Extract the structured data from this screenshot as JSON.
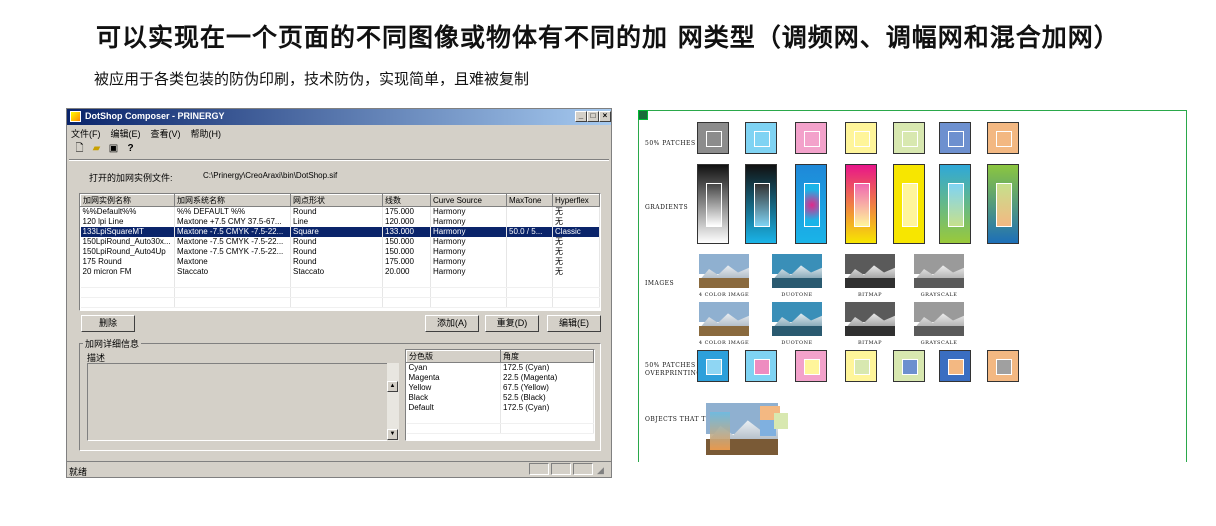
{
  "headline": "可以实现在一个页面的不同图像或物体有不同的加 网类型（调频网、调幅网和混合加网）",
  "subheadline": "被应用于各类包装的防伪印刷，技术防伪，实现简单，且难被复制",
  "window": {
    "title": "DotShop Composer - PRINERGY",
    "caption_buttons": [
      "_",
      "□",
      "×"
    ],
    "menu": [
      "文件(F)",
      "编辑(E)",
      "查看(V)",
      "帮助(H)"
    ],
    "toolbar_icons": [
      "new-file-icon",
      "open-folder-icon",
      "save-icon",
      "help-icon"
    ],
    "open_file_label": "打开的加网实例文件:",
    "open_file_path": "C:\\Prinergy\\CreoAraxi\\bin\\DotShop.sif",
    "columns": [
      "加网实例名称",
      "加网系统名称",
      "网点形状",
      "线数",
      "Curve Source",
      "MaxTone",
      "Hyperflex"
    ],
    "rows": [
      [
        "%%Default%%",
        "%% DEFAULT %%",
        "Round",
        "175.000",
        "Harmony",
        "",
        "无"
      ],
      [
        "120 lpi Line",
        "Maxtone +7.5 CMY 37.5-67...",
        "Line",
        "120.000",
        "Harmony",
        "",
        "无"
      ],
      [
        "133LpiSquareMT",
        "Maxtone -7.5 CMYK -7.5-22...",
        "Square",
        "133.000",
        "Harmony",
        "50.0 / 5...",
        "Classic"
      ],
      [
        "150LpiRound_Auto30x...",
        "Maxtone -7.5 CMYK -7.5-22...",
        "Round",
        "150.000",
        "Harmony",
        "",
        "无"
      ],
      [
        "150LpiRound_Auto4Up",
        "Maxtone -7.5 CMYK -7.5-22...",
        "Round",
        "150.000",
        "Harmony",
        "",
        "无"
      ],
      [
        "175 Round",
        "Maxtone",
        "Round",
        "175.000",
        "Harmony",
        "",
        "无"
      ],
      [
        "20 micron FM",
        "Staccato",
        "Staccato",
        "20.000",
        "Harmony",
        "",
        "无"
      ]
    ],
    "selected_row": 2,
    "buttons": {
      "delete": "删除",
      "add": "添加(A)",
      "duplicate": "重复(D)",
      "edit": "编辑(E)"
    },
    "detail_group_label": "加网详细信息",
    "description_label": "描述",
    "separation_columns": [
      "分色版",
      "角度"
    ],
    "separations": [
      [
        "Cyan",
        "172.5 (Cyan)"
      ],
      [
        "Magenta",
        "22.5 (Magenta)"
      ],
      [
        "Yellow",
        "67.5 (Yellow)"
      ],
      [
        "Black",
        "52.5 (Black)"
      ],
      [
        "Default",
        "172.5 (Cyan)"
      ]
    ],
    "status": "就绪"
  },
  "swatch_panel": {
    "labels": {
      "patches": "50% patches",
      "gradients": "Gradients",
      "images": "Images",
      "overprint": "50% patches Overprinting",
      "trap": "Objects that trap"
    },
    "image_captions": [
      "4 Color Image",
      "Duotone",
      "BitMap",
      "Grayscale"
    ],
    "patch_colors": [
      {
        "outer": "#8c8c8c",
        "inner": "#8c8c8c"
      },
      {
        "outer": "#7fd3f3",
        "inner": "#7fd3f3"
      },
      {
        "outer": "#f3a2cb",
        "inner": "#f3a2cb"
      },
      {
        "outer": "#fff59a",
        "inner": "#fff59a"
      },
      {
        "outer": "#d8e8b0",
        "inner": "#d8e8b0"
      },
      {
        "outer": "#6d90cf",
        "inner": "#6d90cf"
      },
      {
        "outer": "#f3b882",
        "inner": "#f3b882"
      }
    ],
    "overprint_colors": [
      {
        "outer": "#2da0db",
        "inner": "#8fd6f3"
      },
      {
        "outer": "#7fd3f3",
        "inner": "#ee8cc0"
      },
      {
        "outer": "#f3a2cb",
        "inner": "#fff59a"
      },
      {
        "outer": "#fff59a",
        "inner": "#d8e8b0"
      },
      {
        "outer": "#d8e8b0",
        "inner": "#6d90cf"
      },
      {
        "outer": "#3a6ec1",
        "inner": "#f3b882"
      },
      {
        "outer": "#f3b882",
        "inner": "#a0a0a0"
      }
    ],
    "accent_color": "#2aa84a"
  }
}
